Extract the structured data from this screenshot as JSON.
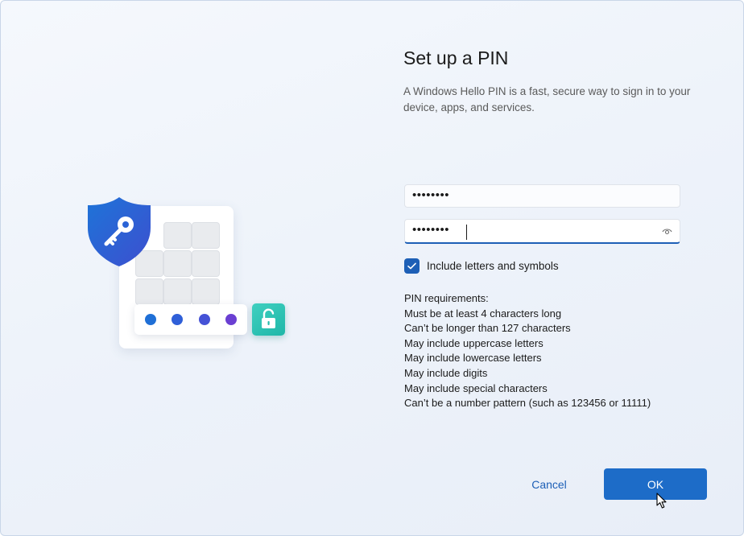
{
  "page": {
    "title": "Set up a PIN",
    "subtitle": "A Windows Hello PIN is a fast, secure way to sign in to your device, apps, and services."
  },
  "pin_field": {
    "value": "••••••••"
  },
  "confirm_field": {
    "value": "••••••••",
    "reveal_icon": "eye-icon"
  },
  "include_letters": {
    "label": "Include letters and symbols",
    "checked": true
  },
  "requirements": {
    "heading": "PIN requirements:",
    "items": [
      "Must be at least 4 characters long",
      "Can’t be longer than 127 characters",
      "May include uppercase letters",
      "May include lowercase letters",
      "May include digits",
      "May include special characters",
      "Can’t be a number pattern (such as 123456 or 11111)"
    ]
  },
  "buttons": {
    "cancel": "Cancel",
    "ok": "OK"
  },
  "illustration": {
    "icons": [
      "shield-key-icon",
      "keypad-icon",
      "unlock-icon"
    ],
    "dot_colors": [
      "#1f6fd6",
      "#2f5fd8",
      "#4552d6",
      "#6a3fd2"
    ]
  },
  "colors": {
    "accent": "#1d6cc8",
    "teal": "#24bcae"
  }
}
